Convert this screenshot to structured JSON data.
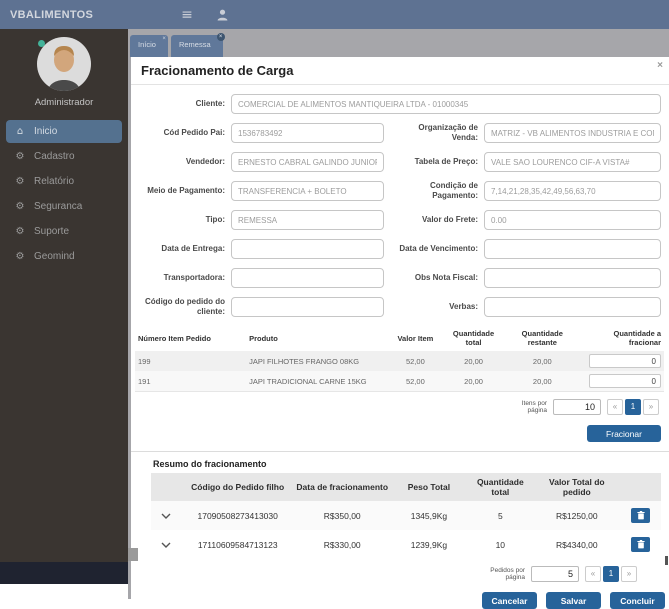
{
  "navbar": {
    "brand": "VBALIMENTOS"
  },
  "sidebar": {
    "user_name": "Administrador",
    "items": [
      {
        "label": "Inicio"
      },
      {
        "label": "Cadastro"
      },
      {
        "label": "Relatório"
      },
      {
        "label": "Seguranca"
      },
      {
        "label": "Suporte"
      },
      {
        "label": "Geomind"
      }
    ]
  },
  "tabs": {
    "inicio": "Início",
    "remessa": "Remessa",
    "close": "×"
  },
  "modal": {
    "title": "Fracionamento de Carga",
    "close": "×"
  },
  "form": {
    "cliente": {
      "label": "Cliente:",
      "value": "COMERCIAL DE ALIMENTOS MANTIQUEIRA LTDA - 01000345"
    },
    "cod_pedido_pai": {
      "label": "Cód Pedido Pai:",
      "value": "1536783492"
    },
    "organizacao_venda": {
      "label": "Organização de Venda:",
      "value": "MATRIZ - VB ALIMENTOS INDUSTRIA E COME"
    },
    "vendedor": {
      "label": "Vendedor:",
      "value": "ERNESTO CABRAL GALINDO JUNIOR ME"
    },
    "tabela_preco": {
      "label": "Tabela de Preço:",
      "value": "VALE SAO LOURENCO CIF-A VISTA#"
    },
    "meio_pagamento": {
      "label": "Meio de Pagamento:",
      "value": "TRANSFERENCIA + BOLETO"
    },
    "condicao_pagamento": {
      "label": "Condição de Pagamento:",
      "value": "7,14,21,28,35,42,49,56,63,70"
    },
    "tipo": {
      "label": "Tipo:",
      "value": "REMESSA"
    },
    "valor_frete": {
      "label": "Valor do Frete:",
      "value": "0.00"
    },
    "data_entrega": {
      "label": "Data de Entrega:",
      "value": ""
    },
    "data_vencimento": {
      "label": "Data de Vencimento:",
      "value": ""
    },
    "transportadora": {
      "label": "Transportadora:",
      "value": ""
    },
    "obs_nota_fiscal": {
      "label": "Obs Nota Fiscal:",
      "value": ""
    },
    "codigo_pedido_cliente": {
      "label": "Código do pedido do cliente:",
      "value": ""
    },
    "verbas": {
      "label": "Verbas:",
      "value": ""
    }
  },
  "items_table": {
    "headers": [
      "Número Item Pedido",
      "Produto",
      "Valor Item",
      "Quantidade total",
      "Quantidade restante",
      "Quantidade a fracionar"
    ],
    "rows": [
      {
        "numero": "199",
        "produto": "JAPI FILHOTES FRANGO 08KG",
        "valor_item": "52,00",
        "qtd_total": "20,00",
        "qtd_restante": "20,00",
        "qtd_fracionar": "0"
      },
      {
        "numero": "191",
        "produto": "JAPI TRADICIONAL CARNE 15KG",
        "valor_item": "52,00",
        "qtd_total": "20,00",
        "qtd_restante": "20,00",
        "qtd_fracionar": "0"
      }
    ],
    "pagination": {
      "label": "Itens por página",
      "page_size": "10",
      "prev": "«",
      "page": "1",
      "next": "»"
    }
  },
  "actions": {
    "fracionar": "Fracionar"
  },
  "resumo": {
    "title": "Resumo do fracionamento",
    "headers": [
      "Código do Pedido filho",
      "Data de fracionamento",
      "Peso Total",
      "Quantidade total",
      "Valor Total do pedido"
    ],
    "rows": [
      {
        "codigo": "17090508273413030",
        "data_fracionamento": "R$350,00",
        "peso_total": "1345,9Kg",
        "qtd_total": "5",
        "valor_total": "R$1250,00"
      },
      {
        "codigo": "17110609584713123",
        "data_fracionamento": "R$330,00",
        "peso_total": "1239,9Kg",
        "qtd_total": "10",
        "valor_total": "R$4340,00"
      }
    ],
    "pagination": {
      "label": "Pedidos por página",
      "page_size": "5",
      "prev": "«",
      "page": "1",
      "next": "»"
    }
  },
  "footer": {
    "cancelar": "Cancelar",
    "salvar": "Salvar",
    "concluir": "Concluir"
  },
  "colors": {
    "accent": "#27639a",
    "navbar": "#5e7292",
    "sidebar": "#3a3531",
    "active_item": "#54718f",
    "backdrop": "#a6a6aa",
    "status": "#43b39a"
  }
}
